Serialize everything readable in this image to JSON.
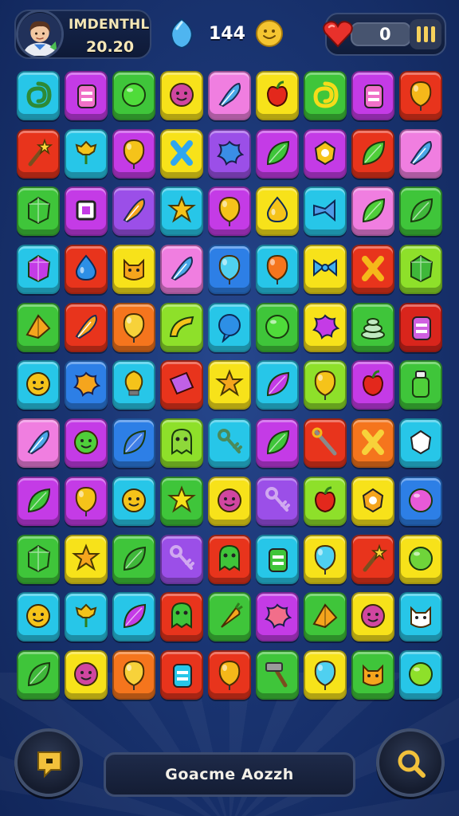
{
  "header": {
    "player_name": "IMDENTHL",
    "player_score": "20.20",
    "gem_count": "144",
    "lives_count": "0"
  },
  "footer": {
    "game_title": "Goacme Aozzh"
  },
  "colors": {
    "cyan": "#27c6e8",
    "magenta": "#c43be6",
    "green": "#3fc53a",
    "yellow": "#f7e21a",
    "violet": "#9b4fe8",
    "red": "#e8341c",
    "pink": "#f07ee0",
    "blue": "#2d7fe6",
    "orange": "#f5751d",
    "lime": "#8ee02a",
    "crimson": "#d9251c"
  },
  "board": {
    "rows": 11,
    "cols": 9,
    "tiles": [
      [
        "cyan:swirl",
        "magenta:jar",
        "green:ball",
        "yellow:face",
        "pink:feather",
        "yellow:apple",
        "green:swirl",
        "magenta:jar",
        "red:balloon"
      ],
      [
        "red:wand",
        "cyan:flower",
        "magenta:balloon",
        "yellow:cross",
        "violet:splash",
        "magenta:leaf",
        "magenta:ring",
        "red:leaf",
        "pink:feather"
      ],
      [
        "green:gem",
        "magenta:square",
        "violet:feather",
        "cyan:star",
        "magenta:balloon",
        "yellow:drop",
        "cyan:trumpet",
        "pink:leaf",
        "green:leaf"
      ],
      [
        "cyan:gem",
        "red:drop",
        "yellow:cat",
        "pink:feather",
        "blue:balloon",
        "cyan:balloon",
        "yellow:bow",
        "red:cross",
        "lime:gem"
      ],
      [
        "green:origami",
        "red:feather",
        "orange:balloon",
        "lime:fan",
        "cyan:bubble",
        "green:ball",
        "yellow:splash",
        "green:cake",
        "crimson:jar"
      ],
      [
        "cyan:face",
        "blue:splash",
        "cyan:bulb",
        "red:block",
        "yellow:star",
        "cyan:leaf",
        "lime:balloon",
        "magenta:apple",
        "green:bottle"
      ],
      [
        "pink:feather",
        "magenta:face",
        "blue:leaf",
        "lime:ghost",
        "cyan:key",
        "magenta:leaf",
        "red:wrench",
        "orange:cross",
        "cyan:ring"
      ],
      [
        "magenta:leaf",
        "magenta:balloon",
        "cyan:face",
        "green:star",
        "yellow:face",
        "violet:key",
        "lime:apple",
        "yellow:ring",
        "blue:ball"
      ],
      [
        "green:gem",
        "yellow:star",
        "green:leaf",
        "violet:key",
        "red:ghost",
        "cyan:jar",
        "yellow:balloon",
        "red:wand",
        "yellow:ball"
      ],
      [
        "cyan:face",
        "cyan:flower",
        "cyan:leaf",
        "red:ghost",
        "green:carrot",
        "magenta:splash",
        "green:origami",
        "yellow:face",
        "cyan:cat"
      ],
      [
        "green:leaf",
        "yellow:face",
        "orange:balloon",
        "red:jar",
        "red:balloon",
        "green:hammer",
        "yellow:balloon",
        "green:cat",
        "cyan:ball"
      ]
    ]
  }
}
